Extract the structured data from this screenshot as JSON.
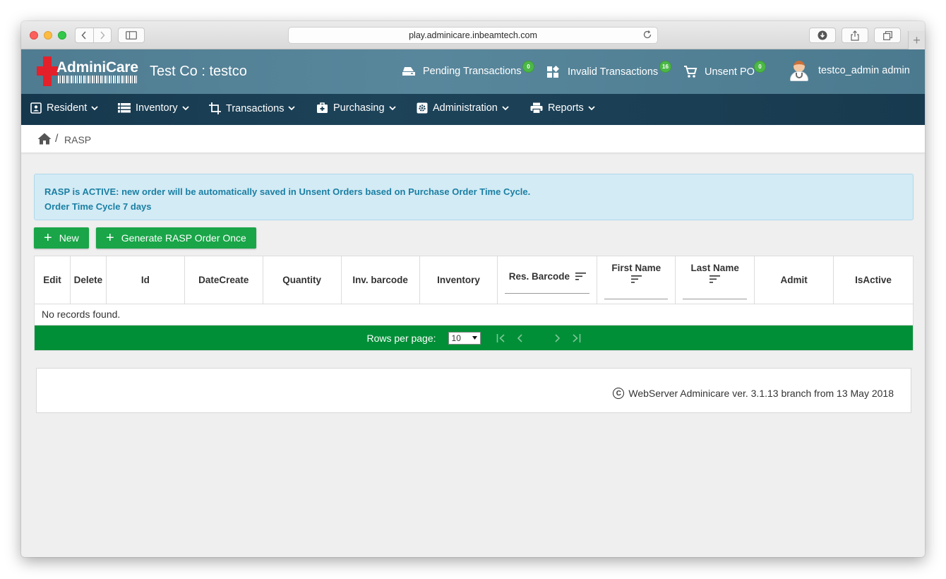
{
  "browser": {
    "url": "play.adminicare.inbeamtech.com",
    "back_icon": "chevron-left-icon",
    "forward_icon": "chevron-right-icon"
  },
  "header": {
    "logo_text": "AdminiCare",
    "company": "Test Co : testco",
    "pending": {
      "label": "Pending Transactions",
      "count": "0"
    },
    "invalid": {
      "label": "Invalid Transactions",
      "count": "16"
    },
    "unsent": {
      "label": "Unsent PO",
      "count": "0"
    },
    "user": "testco_admin admin",
    "colors": {
      "header_bg": "#55849a",
      "menu_bg": "#1b3f55",
      "badge": "#4cb847",
      "logo_red": "#e4202a"
    }
  },
  "menu": {
    "resident": "Resident",
    "inventory": "Inventory",
    "transactions": "Transactions",
    "purchasing": "Purchasing",
    "administration": "Administration",
    "reports": "Reports"
  },
  "breadcrumb": {
    "current": "RASP"
  },
  "alert": {
    "line1": "RASP is ACTIVE: new order will be automatically saved in Unsent Orders based on Purchase Order Time Cycle.",
    "line2": "Order Time Cycle 7 days"
  },
  "actions": {
    "new_label": "New",
    "generate_label": "Generate RASP Order Once",
    "accent": "#19a548"
  },
  "table": {
    "columns": [
      "Edit",
      "Delete",
      "Id",
      "DateCreate",
      "Quantity",
      "Inv. barcode",
      "Inventory",
      "Res. Barcode",
      "First Name",
      "Last Name",
      "Admit",
      "IsActive"
    ],
    "empty_message": "No records found.",
    "rows_per_page_label": "Rows per page:",
    "rows_per_page_value": "10",
    "paginator_color": "#008f37"
  },
  "footer": {
    "text": "WebServer Adminicare ver. 3.1.13 branch from 13 May 2018"
  }
}
